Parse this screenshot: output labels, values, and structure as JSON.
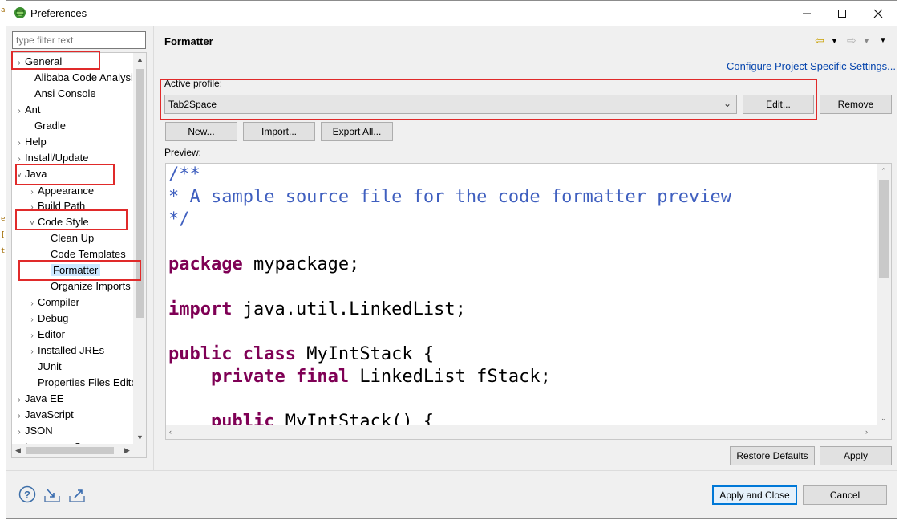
{
  "window": {
    "title": "Preferences"
  },
  "filter": {
    "placeholder": "type filter text"
  },
  "tree": {
    "items": [
      {
        "label": "General",
        "twisty": "›"
      },
      {
        "label": "Alibaba Code Analysis",
        "twisty": ""
      },
      {
        "label": "Ansi Console",
        "twisty": ""
      },
      {
        "label": "Ant",
        "twisty": "›"
      },
      {
        "label": "Gradle",
        "twisty": ""
      },
      {
        "label": "Help",
        "twisty": "›"
      },
      {
        "label": "Install/Update",
        "twisty": "›"
      },
      {
        "label": "Java",
        "twisty": "˅"
      },
      {
        "label": "Appearance",
        "twisty": "›"
      },
      {
        "label": "Build Path",
        "twisty": "›"
      },
      {
        "label": "Code Style",
        "twisty": "˅"
      },
      {
        "label": "Clean Up",
        "twisty": ""
      },
      {
        "label": "Code Templates",
        "twisty": ""
      },
      {
        "label": "Formatter",
        "twisty": ""
      },
      {
        "label": "Organize Imports",
        "twisty": ""
      },
      {
        "label": "Compiler",
        "twisty": "›"
      },
      {
        "label": "Debug",
        "twisty": "›"
      },
      {
        "label": "Editor",
        "twisty": "›"
      },
      {
        "label": "Installed JREs",
        "twisty": "›"
      },
      {
        "label": "JUnit",
        "twisty": ""
      },
      {
        "label": "Properties Files Editor",
        "twisty": ""
      },
      {
        "label": "Java EE",
        "twisty": "›"
      },
      {
        "label": "JavaScript",
        "twisty": "›"
      },
      {
        "label": "JSON",
        "twisty": "›"
      },
      {
        "label": "Language Servers",
        "twisty": "›"
      }
    ],
    "selected": "Formatter"
  },
  "page": {
    "title": "Formatter",
    "config_link": "Configure Project Specific Settings...",
    "active_profile_label": "Active profile:",
    "profile_value": "Tab2Space",
    "edit_label": "Edit...",
    "remove_label": "Remove",
    "new_label": "New...",
    "import_label": "Import...",
    "export_label": "Export All...",
    "preview_label": "Preview:"
  },
  "preview_code": [
    {
      "cls": "cm",
      "text": "/**"
    },
    {
      "cls": "cm",
      "text": "* A sample source file for the code formatter preview"
    },
    {
      "cls": "cm",
      "text": "*/"
    },
    {
      "cls": "",
      "text": ""
    },
    {
      "kw": "package",
      "rest": " mypackage;"
    },
    {
      "cls": "",
      "text": ""
    },
    {
      "kw": "import",
      "rest": " java.util.LinkedList;"
    },
    {
      "cls": "",
      "text": ""
    },
    {
      "kw": "public class",
      "rest": " MyIntStack {"
    },
    {
      "indent": "    ",
      "kw": "private final",
      "rest": " LinkedList fStack;"
    },
    {
      "cls": "",
      "text": ""
    },
    {
      "indent": "    ",
      "kw": "public",
      "rest": " MyIntStack() {"
    }
  ],
  "footer": {
    "restore_defaults": "Restore Defaults",
    "apply": "Apply",
    "apply_and_close": "Apply and Close",
    "cancel": "Cancel"
  },
  "colors": {
    "highlight": "#e02a2a",
    "link": "#0645ad",
    "keyword": "#7f0055",
    "comment": "#3f5fbf",
    "selection": "#cce8ff"
  }
}
